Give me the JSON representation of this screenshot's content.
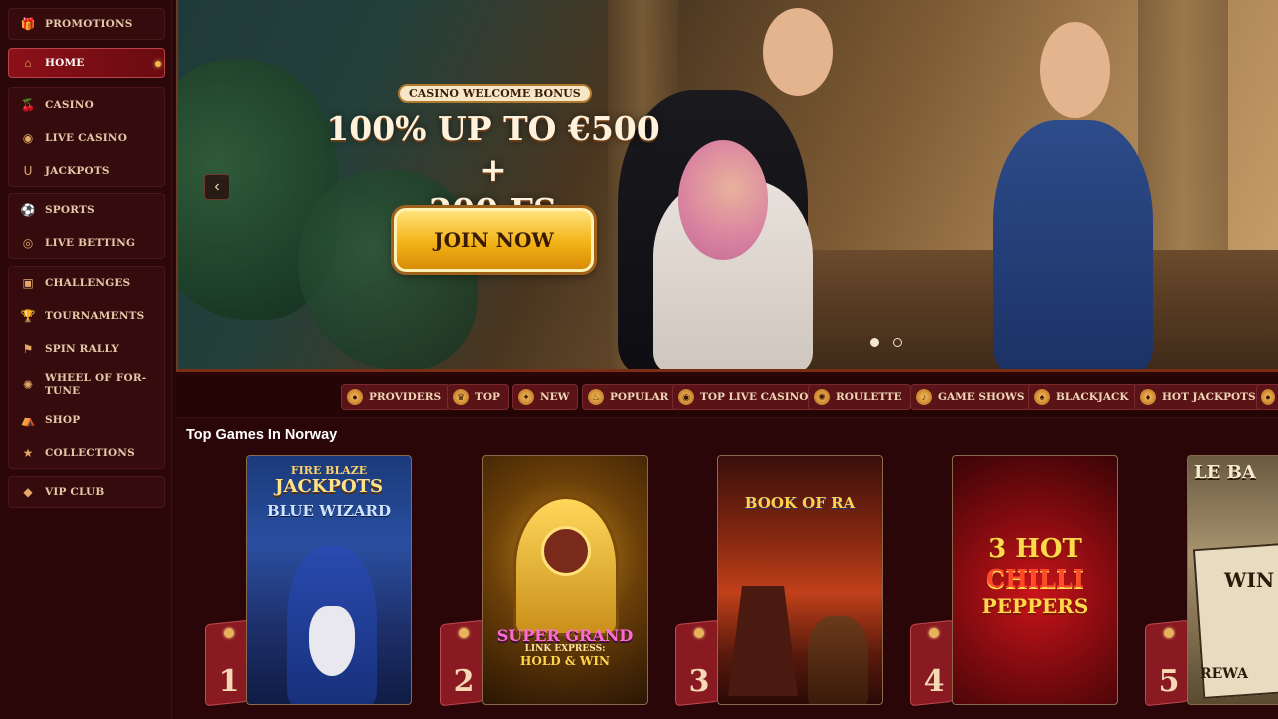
{
  "sidebar": {
    "promotions": {
      "label": "PROMOTIONS",
      "icon": "gift-icon"
    },
    "home": {
      "label": "HOME",
      "icon": "house-icon"
    },
    "casino": {
      "label": "CASINO",
      "icon": "cherries-icon"
    },
    "live_casino": {
      "label": "LIVE CASINO",
      "icon": "chips-icon"
    },
    "jackpots": {
      "label": "JACKPOTS",
      "icon": "horseshoe-icon"
    },
    "sports": {
      "label": "SPORTS",
      "icon": "soccer-ball-icon"
    },
    "live_betting": {
      "label": "LIVE BETTING",
      "icon": "live-icon"
    },
    "challenges": {
      "label": "CHALLENGES",
      "icon": "treasure-icon"
    },
    "tournaments": {
      "label": "TOURNAMENTS",
      "icon": "trophy-icon"
    },
    "spin_rally": {
      "label": "SPIN RALLY",
      "icon": "race-flag-icon"
    },
    "wheel_of_fortune": {
      "label": "WHEEL OF FOR-\nTUNE",
      "icon": "wheel-icon"
    },
    "shop": {
      "label": "SHOP",
      "icon": "shop-icon"
    },
    "collections": {
      "label": "COLLECTIONS",
      "icon": "star-icon"
    },
    "vip_club": {
      "label": "VIP CLUB",
      "icon": "diamond-icon"
    }
  },
  "hero": {
    "tag": "CASINO WELCOME BONUS",
    "title_line1": "100% UP TO €500 +",
    "title_line2": "200 FS",
    "cta": "JOIN NOW",
    "prev_icon": "chevron-left-icon",
    "slides": 2,
    "active_slide": 1
  },
  "categories": [
    {
      "label": "PROVIDERS",
      "icon": "providers-icon"
    },
    {
      "label": "TOP",
      "icon": "crown-icon"
    },
    {
      "label": "NEW",
      "icon": "new-icon"
    },
    {
      "label": "POPULAR",
      "icon": "flame-icon"
    },
    {
      "label": "TOP LIVE CASINO",
      "icon": "live-casino-icon"
    },
    {
      "label": "ROULETTE",
      "icon": "roulette-icon"
    },
    {
      "label": "GAME SHOWS",
      "icon": "microphone-icon"
    },
    {
      "label": "BLACKJACK",
      "icon": "cards-icon"
    },
    {
      "label": "HOT JACKPOTS",
      "icon": "hot-icon"
    }
  ],
  "section_title": "Top Games In Norway",
  "games": [
    {
      "rank": "1",
      "title1": "FIRE BLAZE",
      "title2": "JACKPOTS",
      "title3": "BLUE WIZARD"
    },
    {
      "rank": "2",
      "title1": "SUPER GRAND",
      "title2": "LINK EXPRESS:",
      "title3": "HOLD & WIN"
    },
    {
      "rank": "3",
      "title1": "BOOK OF RA",
      "title2": "",
      "title3": ""
    },
    {
      "rank": "4",
      "title1": "3 HOT",
      "title2": "CHILLI",
      "title3": "PEPPERS"
    },
    {
      "rank": "5",
      "title1": "LE BA",
      "title2": "WIN",
      "title3": "REWA"
    }
  ]
}
